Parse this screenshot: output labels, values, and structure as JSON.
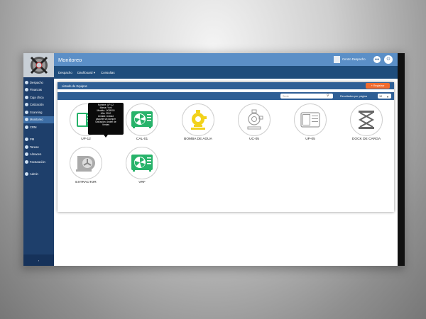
{
  "app": {
    "title": "Monitoreo"
  },
  "user": {
    "name": "Centro Despacho"
  },
  "sidebar": {
    "items": [
      {
        "label": "Despacho"
      },
      {
        "label": "Finanzas"
      },
      {
        "label": "Caja chica"
      },
      {
        "label": "Cotización"
      },
      {
        "label": "Scanning"
      },
      {
        "label": "Monitoreo"
      },
      {
        "label": "CRM"
      },
      {
        "label": "PM"
      },
      {
        "label": "Tareas"
      },
      {
        "label": "Almacen"
      },
      {
        "label": "Facturación"
      },
      {
        "label": "Admin"
      }
    ]
  },
  "menubar": {
    "items": [
      "Despacho",
      "Dashboard ▾",
      "Consultas"
    ]
  },
  "panel": {
    "title": "Listado de Equipos",
    "register_label": "+ Registrar",
    "search_placeholder": "Serie",
    "per_page_label": "Resultados por página",
    "per_page_value": "10"
  },
  "equipment": [
    {
      "label": "UP-12",
      "icon": "ac-unit-icon"
    },
    {
      "label": "CAL-01",
      "icon": "fan-unit-icon"
    },
    {
      "label": "BOMBA DE AGUA",
      "icon": "water-pump-icon"
    },
    {
      "label": "UC-05",
      "icon": "pump-icon"
    },
    {
      "label": "UP-05",
      "icon": "ac-unit-icon"
    },
    {
      "label": "DOCK DE CARGA",
      "icon": "scissor-lift-icon"
    },
    {
      "label": "EXTRACTOR",
      "icon": "extractor-fan-icon"
    },
    {
      "label": "VRF",
      "icon": "fan-unit-icon"
    }
  ],
  "tooltip": {
    "lines": [
      "Nombre: UP-12",
      "Marca: York",
      "Modelo: LX35000",
      "Año: 2010",
      "Unidad: Unidad",
      "paquete sin damper",
      "Ubicación: Andén de",
      "Verdes"
    ]
  },
  "colors": {
    "sidebar": "#1e3f6b",
    "topbar": "#5b8fc7",
    "menubar": "#1f4d7c",
    "accent": "#f26b2e",
    "green_icon": "#27b36a",
    "yellow_icon": "#f2d21b"
  }
}
